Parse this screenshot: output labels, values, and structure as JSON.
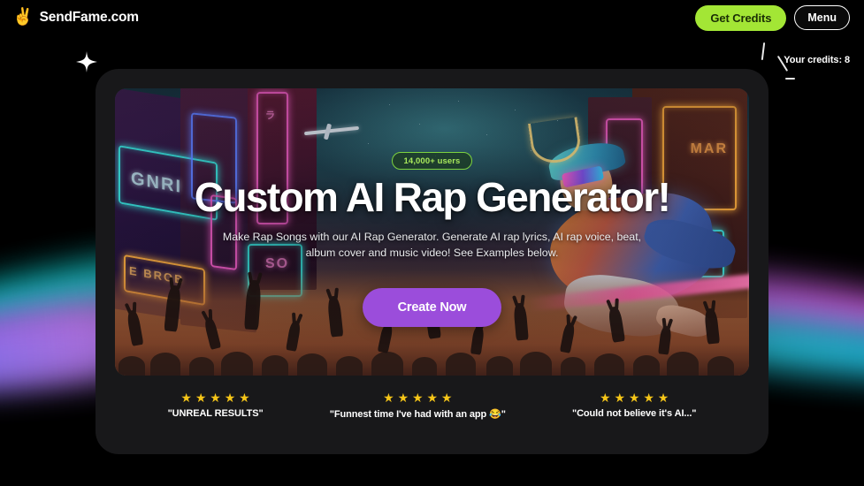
{
  "header": {
    "brand_icon": "victory-hand-emoji",
    "brand_icon_glyph": "✌",
    "brand_name": "SendFame.com",
    "get_credits_label": "Get Credits",
    "menu_label": "Menu",
    "credits_note": "Your credits: 8"
  },
  "hero": {
    "badge": "14,000+ users",
    "title": "Custom AI Rap Generator!",
    "subtitle": "Make Rap Songs with our AI Rap Generator. Generate AI rap lyrics, AI rap voice, beat, album cover and music video! See Examples below.",
    "cta_label": "Create Now",
    "art_description": "neon city street at night with a rapper in cap and visor sunglasses above a cheering crowd"
  },
  "testimonials": [
    {
      "stars": "★ ★ ★ ★ ★",
      "text": "\"UNREAL RESULTS\""
    },
    {
      "stars": "★ ★ ★ ★ ★",
      "text": "\"Funnest time I've had with an app 😂\""
    },
    {
      "stars": "★ ★ ★ ★ ★",
      "text": "\"Could not believe it's AI...\""
    }
  ],
  "colors": {
    "page_background": "#000000",
    "card_background": "#18181a",
    "accent_green": "#a3e635",
    "accent_purple": "#9b4ddb",
    "badge_green": "#a8e85b",
    "star_yellow": "#f5c518",
    "aurora_teal": "#14c3c3",
    "aurora_purple": "#a05fe8",
    "aurora_magenta": "#cd55d7",
    "aurora_cyan": "#19bedc"
  }
}
